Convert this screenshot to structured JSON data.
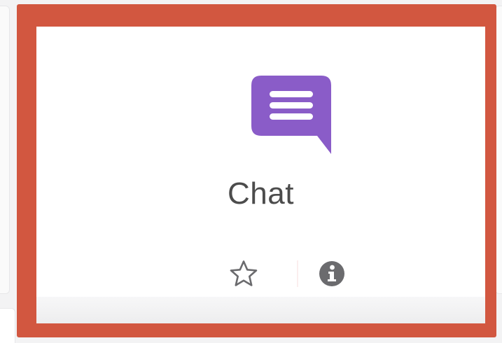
{
  "module": {
    "name": "Chat",
    "icon": "chat-bubble-icon",
    "icon_color": "#8a5cc8"
  },
  "actions": {
    "star_icon": "star-outline-icon",
    "info_icon": "info-circle-icon"
  },
  "colors": {
    "highlight": "#d25740",
    "card_background": "#ffffff",
    "text": "#4c4c4c",
    "action_icon": "#6b6b6e"
  }
}
